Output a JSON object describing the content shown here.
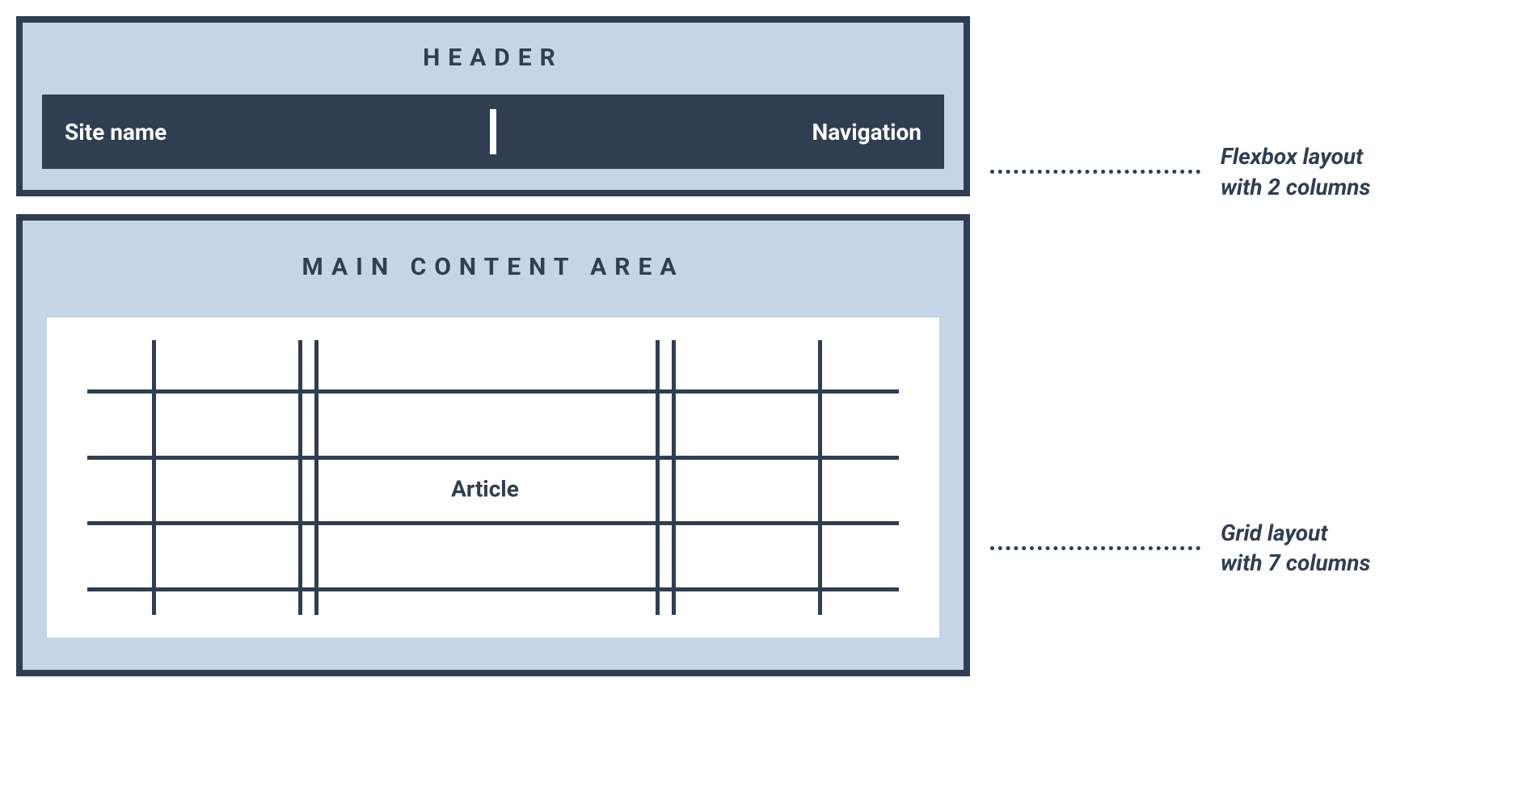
{
  "header": {
    "title": "HEADER",
    "site_name_label": "Site name",
    "navigation_label": "Navigation"
  },
  "main": {
    "title": "MAIN CONTENT AREA",
    "article_label": "Article"
  },
  "annotations": {
    "flexbox": "Flexbox layout\nwith 2 columns",
    "grid": "Grid layout\nwith 7 columns"
  },
  "grid": {
    "columns": 7,
    "rows_shown": 4
  },
  "colors": {
    "panel_bg": "#c3d5e6",
    "border": "#2f3e51",
    "text_dark": "#2f3e51",
    "navbar_bg": "#2f3e51",
    "navbar_text": "#ffffff"
  }
}
